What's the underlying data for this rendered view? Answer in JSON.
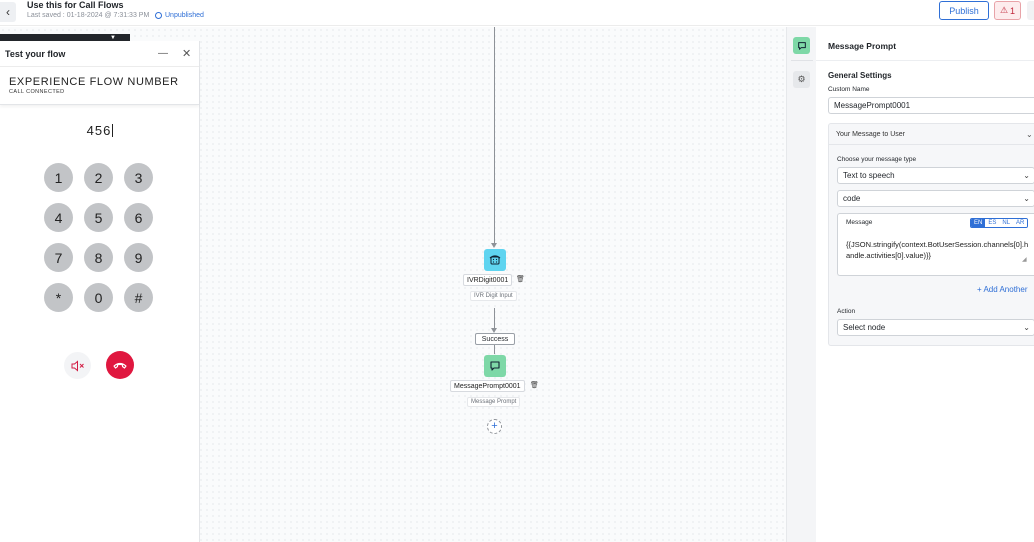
{
  "header": {
    "back_icon": "chevron-left-icon",
    "title": "Use this for Call Flows",
    "last_saved": "Last saved : 01-18-2024 @ 7:31:33 PM",
    "status": "Unpublished",
    "publish_label": "Publish",
    "warning_count": "1"
  },
  "test_panel": {
    "title": "Test your flow",
    "minimize_glyph": "—",
    "close_glyph": "✕",
    "experience_title": "EXPERIENCE FLOW NUMBER",
    "call_status": "CALL CONNECTED",
    "dialed": "456",
    "keypad": [
      "1",
      "2",
      "3",
      "4",
      "5",
      "6",
      "7",
      "8",
      "9",
      "*",
      "0",
      "#"
    ],
    "mute_icon": "speaker-muted-icon",
    "hangup_icon": "phone-hangup-icon"
  },
  "flow": {
    "nodes": [
      {
        "name": "IVRDigit0001",
        "type": "IVR Digit Input",
        "icon": "phone-keypad-icon",
        "color": "#5fd4f0"
      },
      {
        "name": "MessagePrompt0001",
        "type": "Message Prompt",
        "icon": "chat-bubble-icon",
        "color": "#7ed8a7"
      }
    ],
    "edge_label": "Success",
    "add_glyph": "+"
  },
  "properties": {
    "title": "Message Prompt",
    "section": "General Settings",
    "custom_name_label": "Custom Name",
    "custom_name_value": "MessagePrompt0001",
    "accordion_title": "Your Message to User",
    "message_type_label": "Choose your message type",
    "message_type_value": "Text to speech",
    "format_value": "code",
    "message_label": "Message",
    "languages": [
      "EN",
      "ES",
      "NL",
      "AR"
    ],
    "message_value": "{{JSON.stringify(context.BotUserSession.channels[0].handle.activities[0].value)}}",
    "add_another": "+ Add Another",
    "action_label": "Action",
    "action_value": "Select node"
  },
  "colors": {
    "accent": "#2f6fd6",
    "hangup": "#e0173f",
    "ivr_node": "#5fd4f0",
    "message_node": "#7ed8a7"
  }
}
